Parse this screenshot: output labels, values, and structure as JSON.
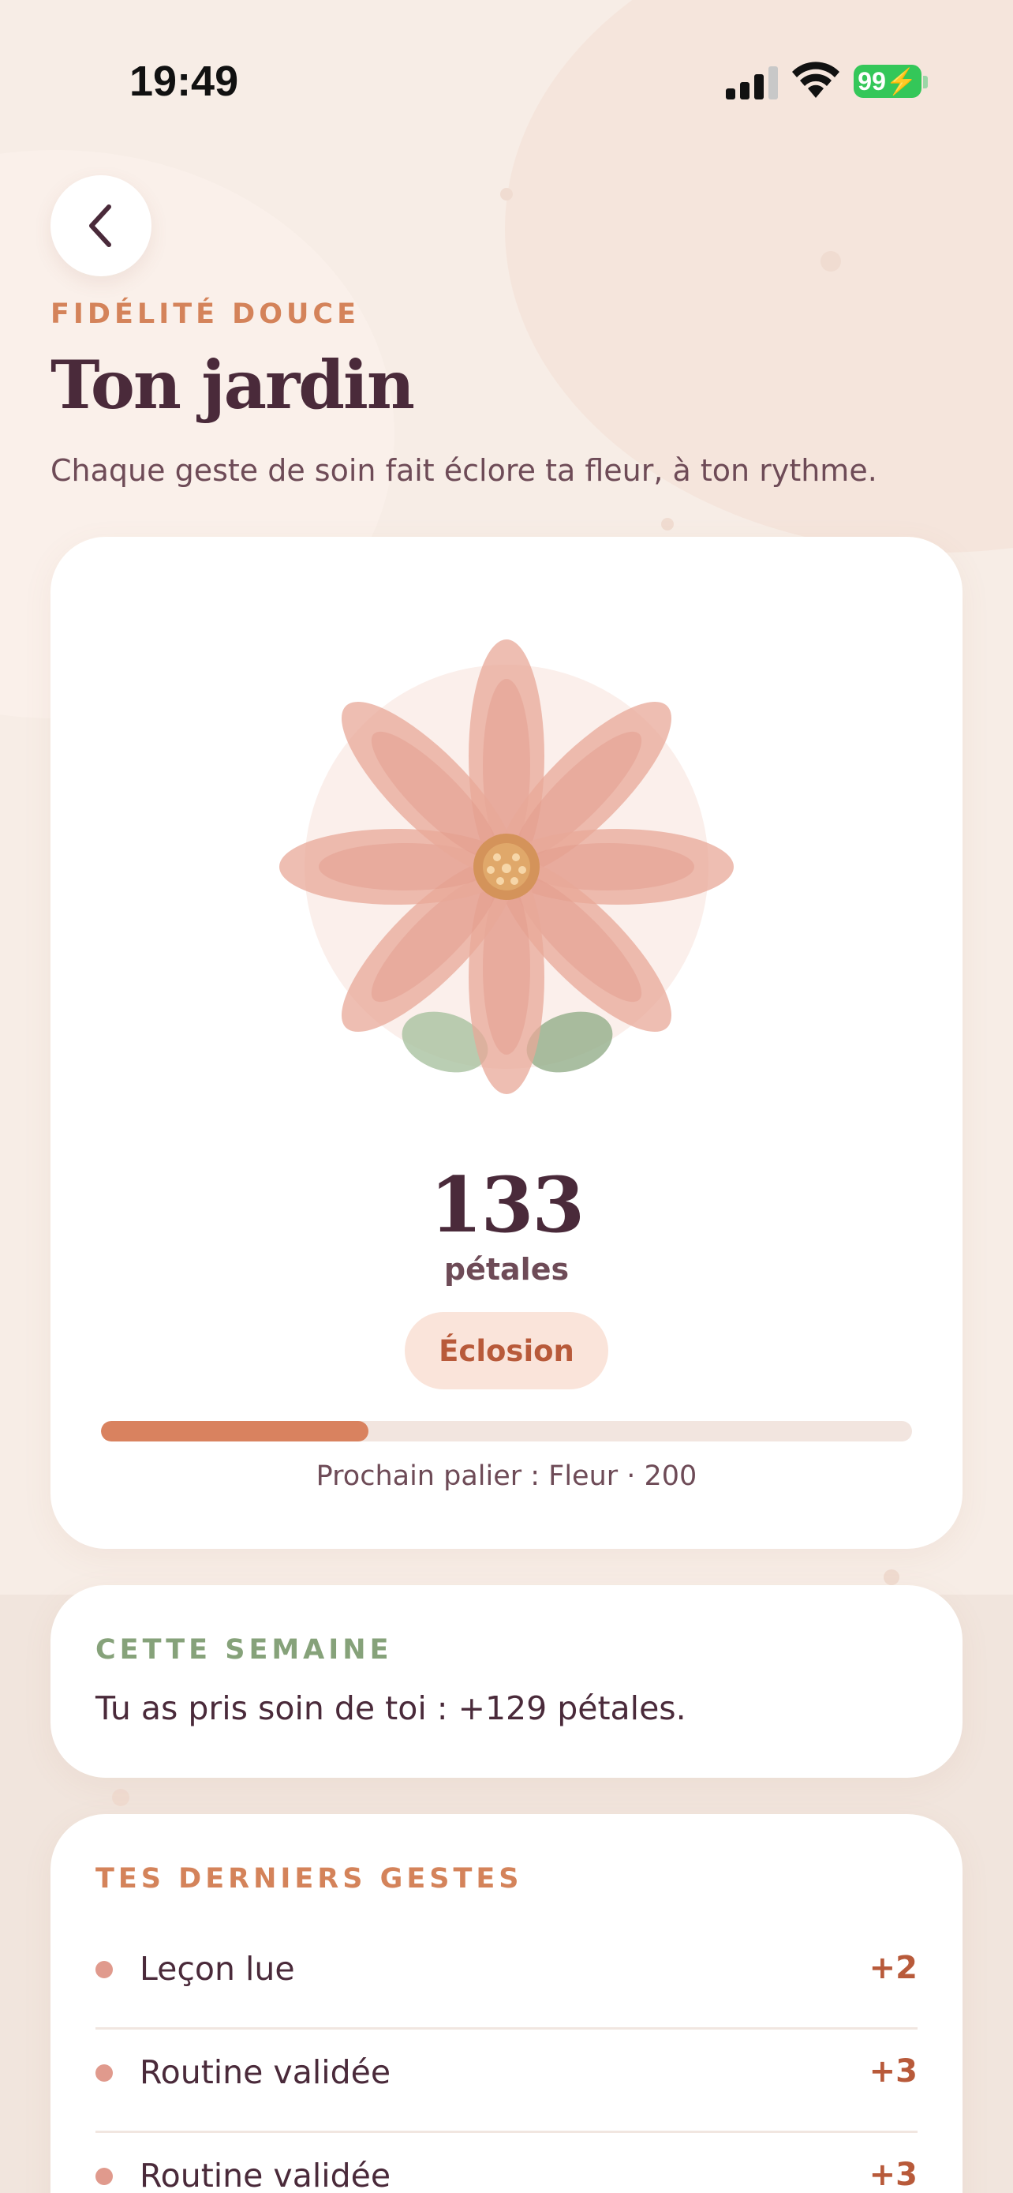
{
  "status_bar": {
    "time": "19:49",
    "battery": "99",
    "icons": [
      "signal-icon",
      "wifi-icon",
      "battery-charging-icon"
    ]
  },
  "header": {
    "back_icon": "chevron-left-icon",
    "eyebrow": "FIDÉLITÉ DOUCE",
    "title": "Ton jardin",
    "subtitle": "Chaque geste de soin fait éclore ta fleur, à ton rythme."
  },
  "hero": {
    "icon": "flower-icon",
    "petals": "133",
    "petals_unit": "pétales",
    "stage": "Éclosion",
    "progress_fraction": 0.33,
    "next_tier": "Prochain palier : Fleur · 200"
  },
  "week": {
    "label": "CETTE SEMAINE",
    "text": "Tu as pris soin de toi : +129 pétales."
  },
  "recent": {
    "label": "TES DERNIERS GESTES",
    "items": [
      {
        "label": "Leçon lue",
        "value": "+2"
      },
      {
        "label": "Routine validée",
        "value": "+3"
      },
      {
        "label": "Routine validée",
        "value": "+3"
      }
    ]
  },
  "colors": {
    "accent": "#d4835a",
    "sage": "#86a27a",
    "petal": "#e8a898",
    "text": "#4a2a3a",
    "battery": "#34c759"
  }
}
